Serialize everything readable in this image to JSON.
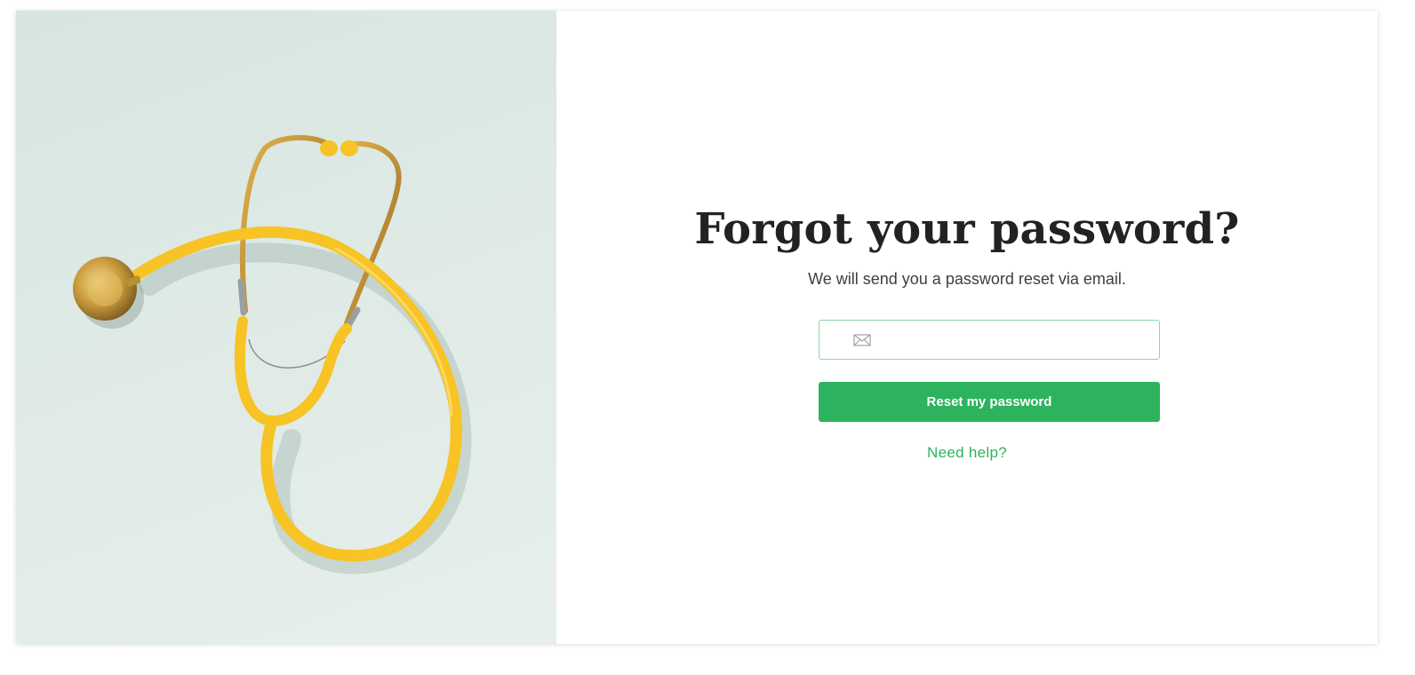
{
  "hero": {
    "image_description": "stethoscope-photo"
  },
  "form": {
    "title": "Forgot your password?",
    "subtitle": "We will send you a password reset via email.",
    "email_placeholder": "",
    "email_value": "",
    "submit_label": "Reset my password",
    "help_link_label": "Need help?"
  },
  "colors": {
    "accent": "#2db35e",
    "field_border": "#8fd6a8",
    "hero_background": "#dfeae5",
    "tubing": "#f7c325"
  },
  "icons": {
    "email_field_icon": "mail-icon"
  }
}
